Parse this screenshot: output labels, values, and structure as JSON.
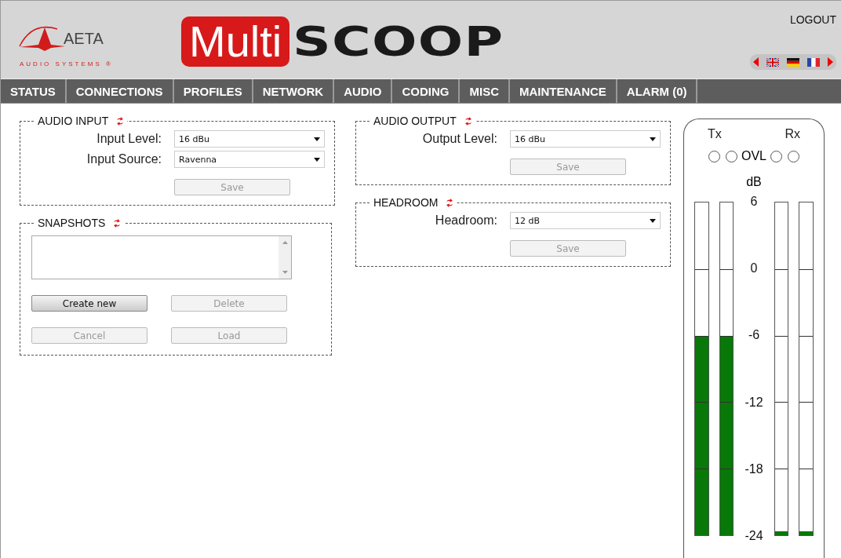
{
  "header": {
    "brand": "AETA",
    "tagline": "AUDIO SYSTEMS ®",
    "product_part1": "Multi",
    "product_part2": "SCOOP",
    "logout": "LOGOUT"
  },
  "nav": [
    "STATUS",
    "CONNECTIONS",
    "PROFILES",
    "NETWORK",
    "AUDIO",
    "CODING",
    "MISC",
    "MAINTENANCE",
    "ALARM (0)"
  ],
  "left_panels": [
    {
      "kind": "form",
      "title": "AUDIO INPUT",
      "fields": [
        {
          "label": "Input Level:",
          "value": "16 dBu"
        },
        {
          "label": "Input Source:",
          "value": "Ravenna"
        }
      ],
      "save": {
        "label": "Save",
        "disabled": true
      }
    },
    {
      "kind": "snapshots",
      "title": "SNAPSHOTS",
      "buttons": [
        {
          "label": "Create new",
          "disabled": false
        },
        {
          "label": "Delete",
          "disabled": true
        },
        {
          "label": "Cancel",
          "disabled": true
        },
        {
          "label": "Load",
          "disabled": true
        }
      ]
    }
  ],
  "right_panels": [
    {
      "kind": "form",
      "title": "AUDIO OUTPUT",
      "fields": [
        {
          "label": "Output Level:",
          "value": "16 dBu"
        }
      ],
      "save": {
        "label": "Save",
        "disabled": true
      }
    },
    {
      "kind": "form",
      "title": "HEADROOM",
      "fields": [
        {
          "label": "Headroom:",
          "value": "12 dB"
        }
      ],
      "save": {
        "label": "Save",
        "disabled": true
      }
    }
  ],
  "meter": {
    "tx_label": "Tx",
    "rx_label": "Rx",
    "ovl_label": "OVL",
    "unit": "dB",
    "scale": [
      "6",
      "0",
      "-6",
      "-12",
      "-18",
      "-24"
    ],
    "tx": [
      {
        "level": 0.6
      },
      {
        "level": 0.6
      }
    ],
    "rx": [
      {
        "level": 0.012
      },
      {
        "level": 0.012
      }
    ]
  }
}
